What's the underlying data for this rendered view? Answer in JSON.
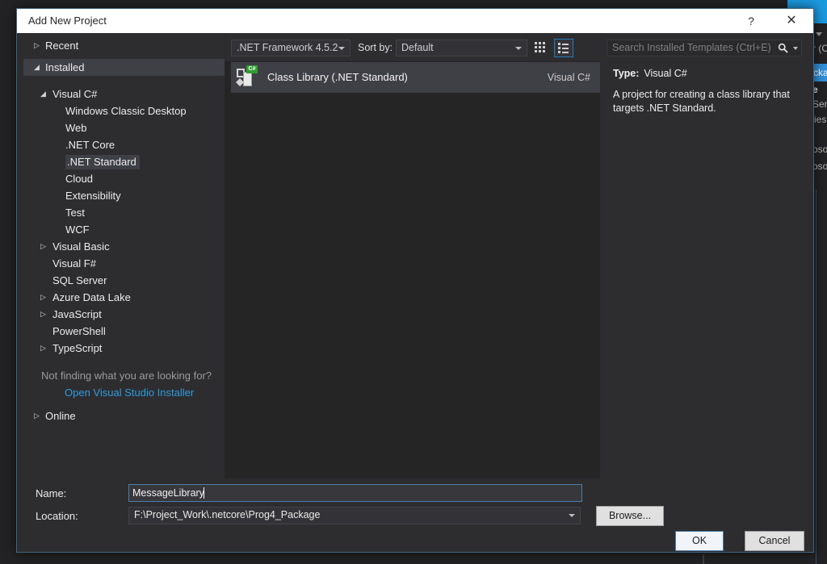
{
  "window": {
    "title": "Add New Project",
    "help_icon": "?",
    "close_icon": "✕"
  },
  "background": {
    "fragments": {
      "f1": "r (C",
      "f2": "cka",
      "f3": "e",
      "f4": "Serv",
      "f5": "ies",
      "f6": "osof",
      "f7": "osof"
    }
  },
  "sidebar": {
    "items": [
      {
        "label": "Recent"
      },
      {
        "label": "Installed"
      },
      {
        "label": "Visual C#"
      },
      {
        "label": "Windows Classic Desktop"
      },
      {
        "label": "Web"
      },
      {
        "label": ".NET Core"
      },
      {
        "label": ".NET Standard"
      },
      {
        "label": "Cloud"
      },
      {
        "label": "Extensibility"
      },
      {
        "label": "Test"
      },
      {
        "label": "WCF"
      },
      {
        "label": "Visual Basic"
      },
      {
        "label": "Visual F#"
      },
      {
        "label": "SQL Server"
      },
      {
        "label": "Azure Data Lake"
      },
      {
        "label": "JavaScript"
      },
      {
        "label": "PowerShell"
      },
      {
        "label": "TypeScript"
      },
      {
        "label": "Online"
      }
    ],
    "not_finding": "Not finding what you are looking for?",
    "installer_link": "Open Visual Studio Installer"
  },
  "toolbar": {
    "framework_dropdown": ".NET Framework 4.5.2",
    "sort_by_label": "Sort by:",
    "sort_dropdown": "Default"
  },
  "template": {
    "name": "Class Library (.NET Standard)",
    "language": "Visual C#",
    "icon_badge": "C#"
  },
  "search": {
    "placeholder": "Search Installed Templates (Ctrl+E)"
  },
  "info": {
    "type_label": "Type:",
    "type_value": "Visual C#",
    "description": "A project for creating a class library that targets .NET Standard."
  },
  "form": {
    "name_label": "Name:",
    "name_value": "MessageLibrary",
    "location_label": "Location:",
    "location_value": "F:\\Project_Work\\.netcore\\Prog4_Package",
    "browse_button": "Browse...",
    "ok_button": "OK",
    "cancel_button": "Cancel"
  }
}
